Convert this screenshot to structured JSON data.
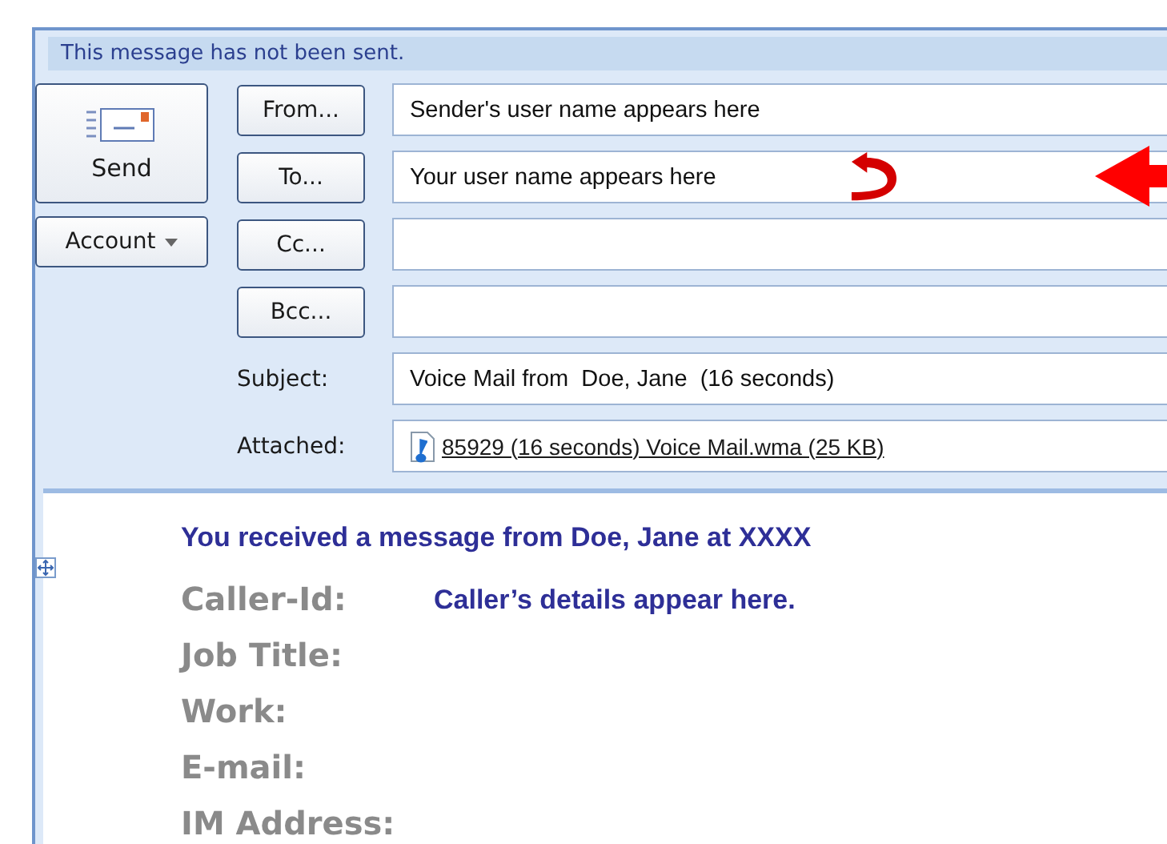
{
  "info_bar": {
    "text": "This message has not been sent."
  },
  "send_button": {
    "label": "Send"
  },
  "account_button": {
    "label": "Account"
  },
  "address_rows": [
    {
      "button": "From...",
      "value": "Sender's user name appears here"
    },
    {
      "button": "To...",
      "value": "Your user name appears here"
    },
    {
      "button": "Cc..."
    },
    {
      "button": "Bcc..."
    }
  ],
  "subject": {
    "label": "Subject:",
    "value": "Voice Mail from  Doe, Jane  (16 seconds)"
  },
  "attachment": {
    "label": "Attached:",
    "file": "85929 (16 seconds) Voice Mail.wma (25 KB)"
  },
  "body": {
    "heading": "You received a message from Doe, Jane at XXXX",
    "fields": [
      {
        "label": "Caller-Id:",
        "value": "Caller’s details appear here."
      },
      {
        "label": "Job Title:"
      },
      {
        "label": "Work:"
      },
      {
        "label": "E-mail:"
      },
      {
        "label": "IM Address:"
      }
    ]
  }
}
